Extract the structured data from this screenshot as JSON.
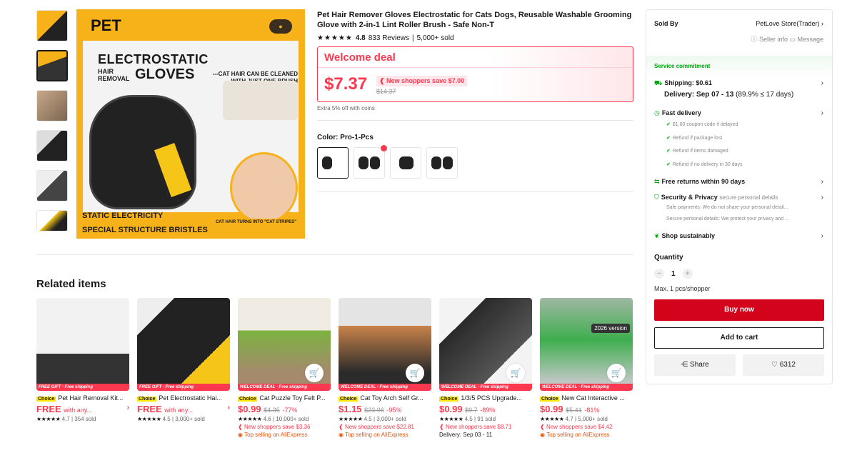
{
  "product": {
    "title": "Pet Hair Remover Gloves Electrostatic for Cats Dogs, Reusable Washable Grooming Glove with 2-in-1 Lint Roller Brush - Safe Non-T",
    "stars": "★★★★★",
    "rating": "4.8",
    "reviews": "833 Reviews",
    "sold": "5,000+ sold",
    "deal_label": "Welcome deal",
    "price": "$7.37",
    "save_text": "New shoppers save $7.00",
    "original_price": "$14.37",
    "coins_text": "Extra 5% off with coins",
    "color_label": "Color: Pro-1-Pcs"
  },
  "main_image": {
    "brand": "PET",
    "line1": "ELECTROSTATIC",
    "line2a": "HAIR",
    "line2b": "REMOVAL",
    "line3": "GLOVES",
    "tagline": "---CAT HAIR CAN BE CLEANED WITH JUST ONE BRUSH",
    "footer1": "STATIC ELECTRICITY",
    "footer2": "SPECIAL STRUCTURE BRISTLES",
    "badge": "CAT HAIR TURNS INTO \"CAT STRIPES\""
  },
  "seller": {
    "sold_by_label": "Sold By",
    "store_name": "PetLove Store(Trader) ›",
    "links": "ⓘ Seller info  ▭ Message"
  },
  "service": {
    "header": "Service commitment",
    "shipping": "Shipping: $0.61",
    "delivery": "Delivery: Sep 07 - 13",
    "delivery_note": "(89.9% ≤ 17 days)",
    "fast_delivery": "Fast delivery",
    "fast_items": [
      "$1.00 coupon code if delayed",
      "Refund if package lost",
      "Refund if items damaged",
      "Refund if no delivery in 30 days"
    ],
    "returns": "Free returns within 90 days",
    "security": "Security & Privacy",
    "security_note": "secure personal details",
    "security_items": [
      "Safe payments: We do not share your personal detail...",
      "Secure personal details: We protect your privacy and ..."
    ],
    "sustainable": "Shop sustainably"
  },
  "quantity": {
    "label": "Quantity",
    "value": "1",
    "max": "Max. 1 pcs/shopper"
  },
  "actions": {
    "buy": "Buy now",
    "cart": "Add to cart",
    "share": "Share",
    "favorites": "6312"
  },
  "related": {
    "title": "Related items",
    "items": [
      {
        "banner": "FREE GIFT · Free shipping",
        "choice": "Choice",
        "title": "Pet Hair Removal Kit...",
        "price": "FREE",
        "extra": "with any...",
        "stars": "★★★★★",
        "rating": "4.7 | 354 sold"
      },
      {
        "banner": "FREE GIFT · Free shipping",
        "choice": "Choice",
        "title": "Pet Electrostatic Hai...",
        "price": "FREE",
        "extra": "with any...",
        "stars": "★★★★★",
        "rating": "4.5 | 3,000+ sold"
      },
      {
        "banner": "WELCOME DEAL · Free shipping",
        "choice": "Choice",
        "title": "Cat Puzzle Toy Felt P...",
        "price": "$0.99",
        "orig": "$4.35",
        "disc": "-77%",
        "stars": "★★★★★",
        "rating": "4.6 | 10,000+ sold",
        "line1": "New shoppers save $3.36",
        "line2": "Top selling on AliExpress"
      },
      {
        "banner": "WELCOME DEAL · Free shipping",
        "choice": "Choice",
        "title": "Cat Toy Arch Self Gr...",
        "price": "$1.15",
        "orig": "$23.96",
        "disc": "-95%",
        "stars": "★★★★★",
        "rating": "4.5 | 3,000+ sold",
        "line1": "New shoppers save $22.81",
        "line2": "Top selling on AliExpress"
      },
      {
        "banner": "WELCOME DEAL · Free shipping",
        "choice": "Choice",
        "title": "1/3/5 PCS Upgrade...",
        "price": "$0.99",
        "orig": "$9.7",
        "disc": "-89%",
        "stars": "★★★★★",
        "rating": "4.5 | 91 sold",
        "line1": "New shoppers save $8.71",
        "line3": "Delivery: Sep 03 - 11"
      },
      {
        "banner": "WELCOME DEAL · Free shipping",
        "choice": "Choice",
        "title": "New Cat Interactive ...",
        "price": "$0.99",
        "orig": "$5.41",
        "disc": "-81%",
        "stars": "★★★★★",
        "rating": "4.7 | 5,000+ sold",
        "line1": "New shoppers save $4.42",
        "line2": "Top selling on AliExpress"
      }
    ]
  },
  "colors": {
    "accent": "#fd384f",
    "buy": "#d3031c",
    "green": "#00a30e",
    "brand_yellow": "#f7b21a"
  }
}
